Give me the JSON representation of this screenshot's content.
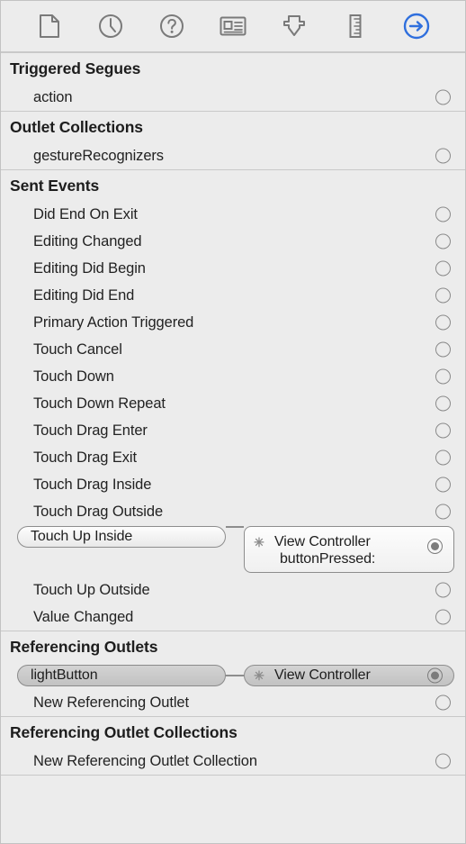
{
  "toolbar": {
    "items": [
      {
        "name": "file-inspector-icon",
        "label": "File Inspector",
        "selected": false
      },
      {
        "name": "history-inspector-icon",
        "label": "History Inspector",
        "selected": false
      },
      {
        "name": "quick-help-inspector-icon",
        "label": "Quick Help Inspector",
        "selected": false
      },
      {
        "name": "identity-inspector-icon",
        "label": "Identity Inspector",
        "selected": false
      },
      {
        "name": "attributes-inspector-icon",
        "label": "Attributes Inspector",
        "selected": false
      },
      {
        "name": "size-inspector-icon",
        "label": "Size Inspector",
        "selected": false
      },
      {
        "name": "connections-inspector-icon",
        "label": "Connections Inspector",
        "selected": true
      }
    ],
    "accent_color": "#2f6fdd",
    "icon_color": "#7a7a7a"
  },
  "sections": [
    {
      "title": "Triggered Segues",
      "rows": [
        {
          "label": "action",
          "connected": false
        }
      ]
    },
    {
      "title": "Outlet Collections",
      "rows": [
        {
          "label": "gestureRecognizers",
          "connected": false
        }
      ]
    },
    {
      "title": "Sent Events",
      "rows": [
        {
          "label": "Did End On Exit",
          "connected": false
        },
        {
          "label": "Editing Changed",
          "connected": false
        },
        {
          "label": "Editing Did Begin",
          "connected": false
        },
        {
          "label": "Editing Did End",
          "connected": false
        },
        {
          "label": "Primary Action Triggered",
          "connected": false
        },
        {
          "label": "Touch Cancel",
          "connected": false
        },
        {
          "label": "Touch Down",
          "connected": false
        },
        {
          "label": "Touch Down Repeat",
          "connected": false
        },
        {
          "label": "Touch Drag Enter",
          "connected": false
        },
        {
          "label": "Touch Drag Exit",
          "connected": false
        },
        {
          "label": "Touch Drag Inside",
          "connected": false
        },
        {
          "label": "Touch Drag Outside",
          "connected": false
        },
        {
          "label": "Touch Up Outside",
          "connected": false
        },
        {
          "label": "Value Changed",
          "connected": false
        }
      ]
    },
    {
      "title": "Referencing Outlets",
      "rows": [
        {
          "label": "New Referencing Outlet",
          "connected": false
        }
      ]
    },
    {
      "title": "Referencing Outlet Collections",
      "rows": [
        {
          "label": "New Referencing Outlet Collection",
          "connected": false
        }
      ]
    }
  ],
  "connections": {
    "touch_up_inside": {
      "source_label": "Touch Up Inside",
      "target_object": "View Controller",
      "target_action": "buttonPressed:",
      "delete_glyph": "✳",
      "connected": true
    },
    "light_button": {
      "source_label": "lightButton",
      "target_object": "View Controller",
      "delete_glyph": "✳",
      "connected": true
    }
  }
}
